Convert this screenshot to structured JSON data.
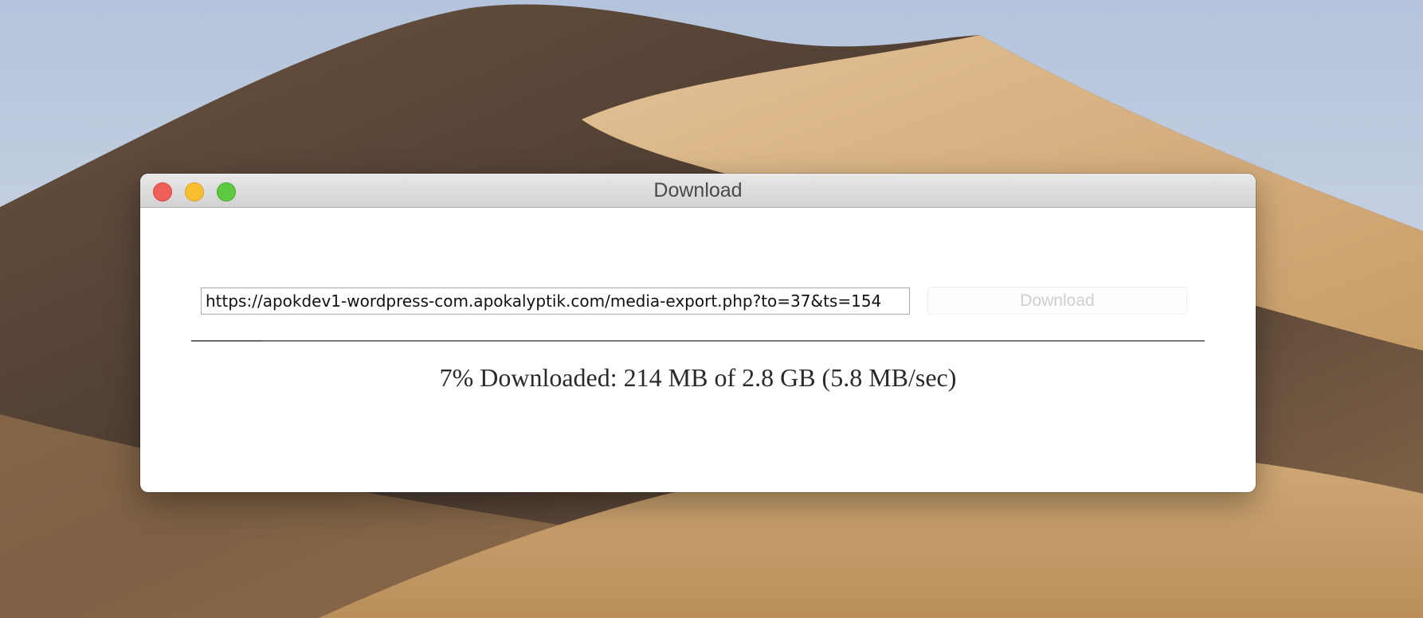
{
  "window": {
    "title": "Download"
  },
  "url_field": {
    "value": "https://apokdev1-wordpress-com.apokalyptik.com/media-export.php?to=37&ts=154"
  },
  "download_button": {
    "label": "Download",
    "enabled": false
  },
  "progress": {
    "percent": 7,
    "status_text": "7% Downloaded: 214 MB of 2.8 GB (5.8 MB/sec)"
  },
  "icons": {
    "close": "close-icon",
    "minimize": "minimize-icon",
    "zoom": "zoom-icon"
  },
  "colors": {
    "close": "#ee5f58",
    "minimize": "#f7bf30",
    "zoom": "#5dc840"
  }
}
